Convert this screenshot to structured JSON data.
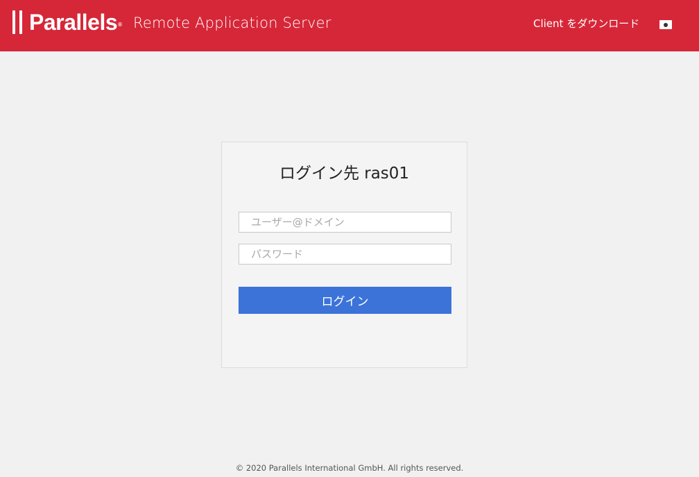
{
  "header": {
    "brand": "Parallels",
    "brand_mark": "®",
    "product": "Remote Application Server",
    "download_label": "Client をダウンロード",
    "language_icon": "japan-flag-icon",
    "background_color": "#d62738"
  },
  "login": {
    "title": "ログイン先 ras01",
    "username_placeholder": "ユーザー@ドメイン",
    "username_value": "",
    "password_placeholder": "パスワード",
    "password_value": "",
    "submit_label": "ログイン",
    "button_color": "#3b73d9"
  },
  "footer": {
    "copyright": "© 2020 Parallels International GmbH. All rights reserved."
  }
}
